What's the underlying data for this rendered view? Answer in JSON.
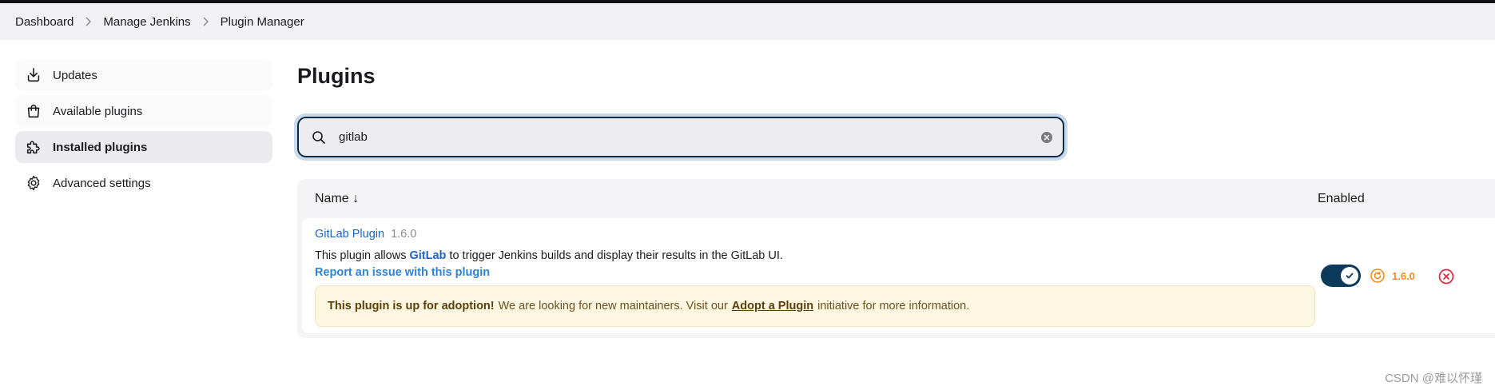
{
  "breadcrumb": {
    "items": [
      "Dashboard",
      "Manage Jenkins",
      "Plugin Manager"
    ]
  },
  "sidebar": {
    "items": [
      {
        "label": "Updates",
        "icon": "download-icon"
      },
      {
        "label": "Available plugins",
        "icon": "shopping-bag-icon"
      },
      {
        "label": "Installed plugins",
        "icon": "puzzle-icon",
        "active": true
      },
      {
        "label": "Advanced settings",
        "icon": "gear-icon"
      }
    ]
  },
  "main": {
    "title": "Plugins",
    "search": {
      "value": "gitlab",
      "placeholder": ""
    },
    "table": {
      "col_name": "Name ↓",
      "col_enabled": "Enabled"
    },
    "plugin": {
      "name": "GitLab Plugin",
      "version": "1.6.0",
      "desc_before": "This plugin allows ",
      "desc_keyword": "GitLab",
      "desc_after": " to trigger Jenkins builds and display their results in the GitLab UI.",
      "report_link": "Report an issue with this plugin",
      "adoption_strong": "This plugin is up for adoption!",
      "adoption_text1": "We are looking for new maintainers. Visit our",
      "adoption_link": "Adopt a Plugin",
      "adoption_text2": "initiative for more information.",
      "enabled": true,
      "downgrade_version": "1.6.0"
    }
  },
  "colors": {
    "accent": "#0b3a5a",
    "link": "#1c63c4",
    "warning": "#ef8d1d",
    "danger": "#e0283c"
  },
  "watermark": "CSDN @难以怀瑾"
}
